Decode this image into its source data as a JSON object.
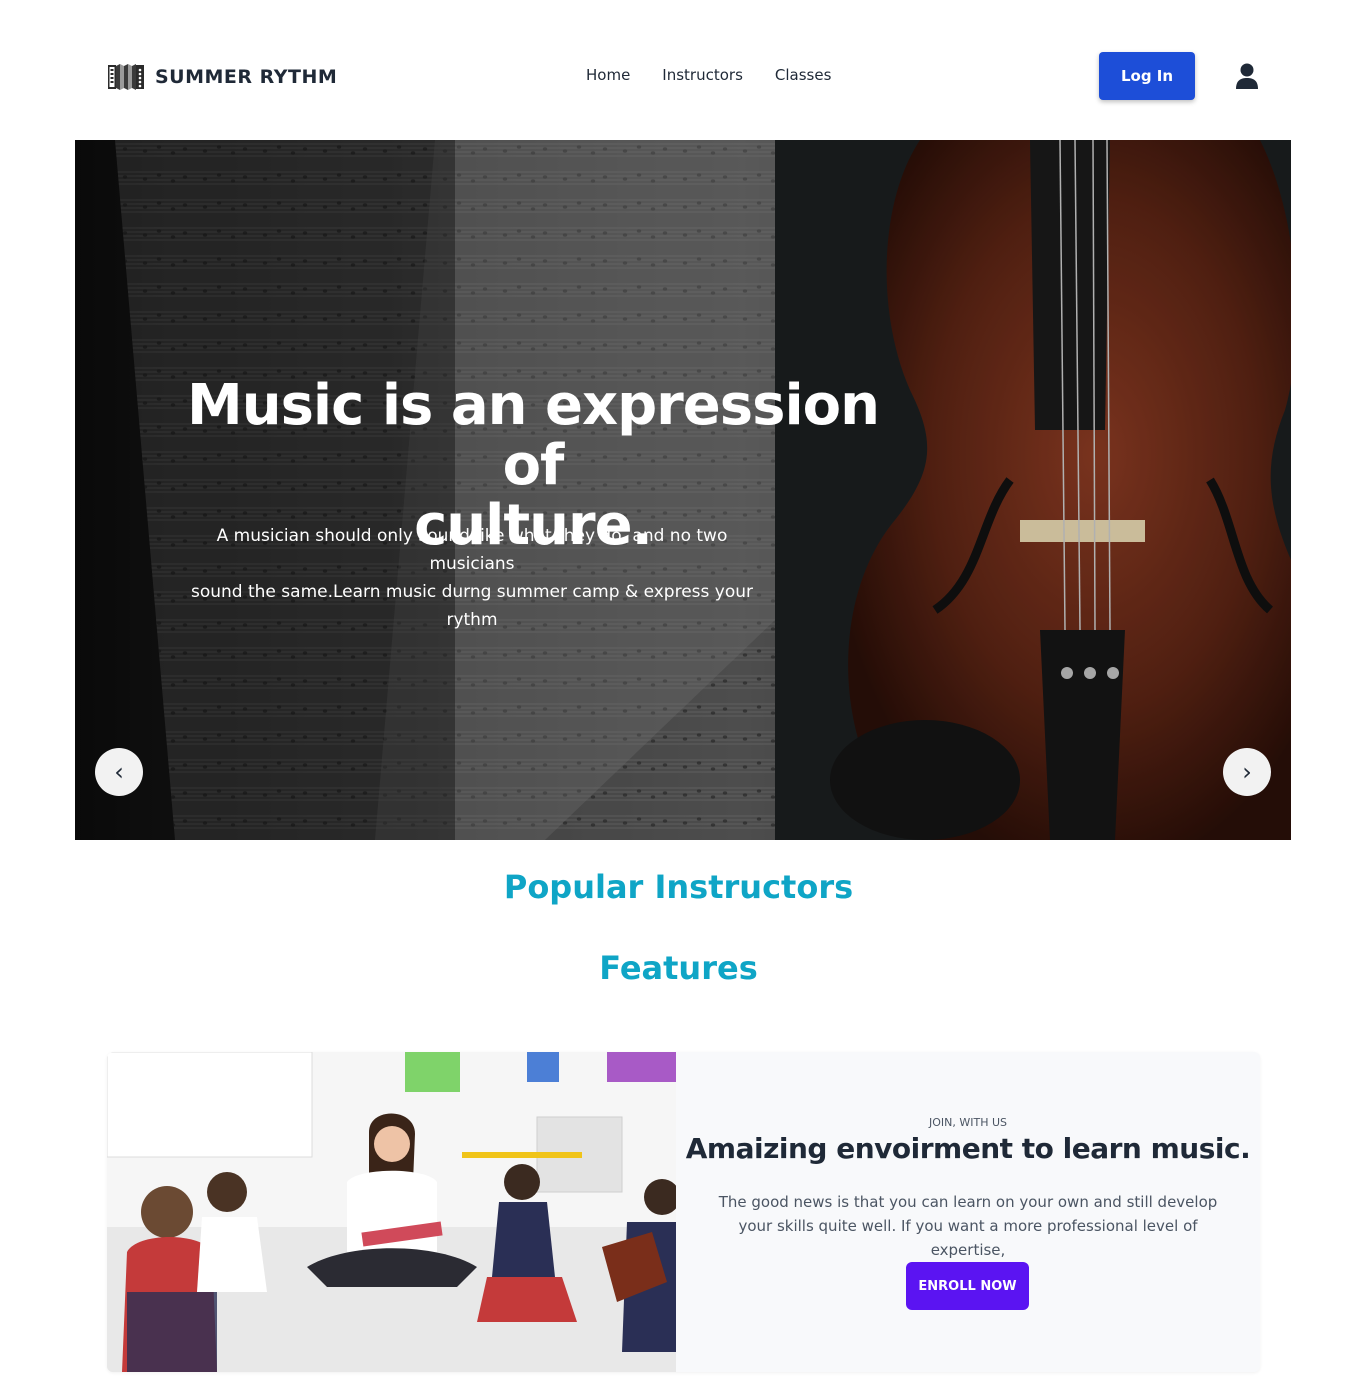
{
  "brand": {
    "name": "SUMMER RYTHM",
    "logo_icon": "accordion-icon"
  },
  "nav": {
    "links": [
      "Home",
      "Instructors",
      "Classes"
    ],
    "login_label": "Log In",
    "user_icon": "user-icon"
  },
  "hero": {
    "title_line1": "Music is an expression of",
    "title_line2": "culture.",
    "subtitle_line1": "A musician should only sound like what they do, and no two musicians",
    "subtitle_line2": "sound the same.Learn music durng summer camp & express your",
    "subtitle_line3": "rythm",
    "prev_label": "‹",
    "next_label": "›"
  },
  "sections": {
    "instructors_heading": "Popular Instructors",
    "features_heading": "Features"
  },
  "feature_card": {
    "kicker": "JOIN, WITH US",
    "title": "Amaizing envoirment to learn music.",
    "text": "The good news is that you can learn on your own and still develop your skills quite well. If you want a more professional level of expertise,",
    "button_label": "ENROLL NOW"
  },
  "colors": {
    "primary_blue": "#1d4ed8",
    "heading_teal": "#0fa5c6",
    "enroll_purple": "#5b14f2",
    "card_bg": "#f8f9fb"
  }
}
